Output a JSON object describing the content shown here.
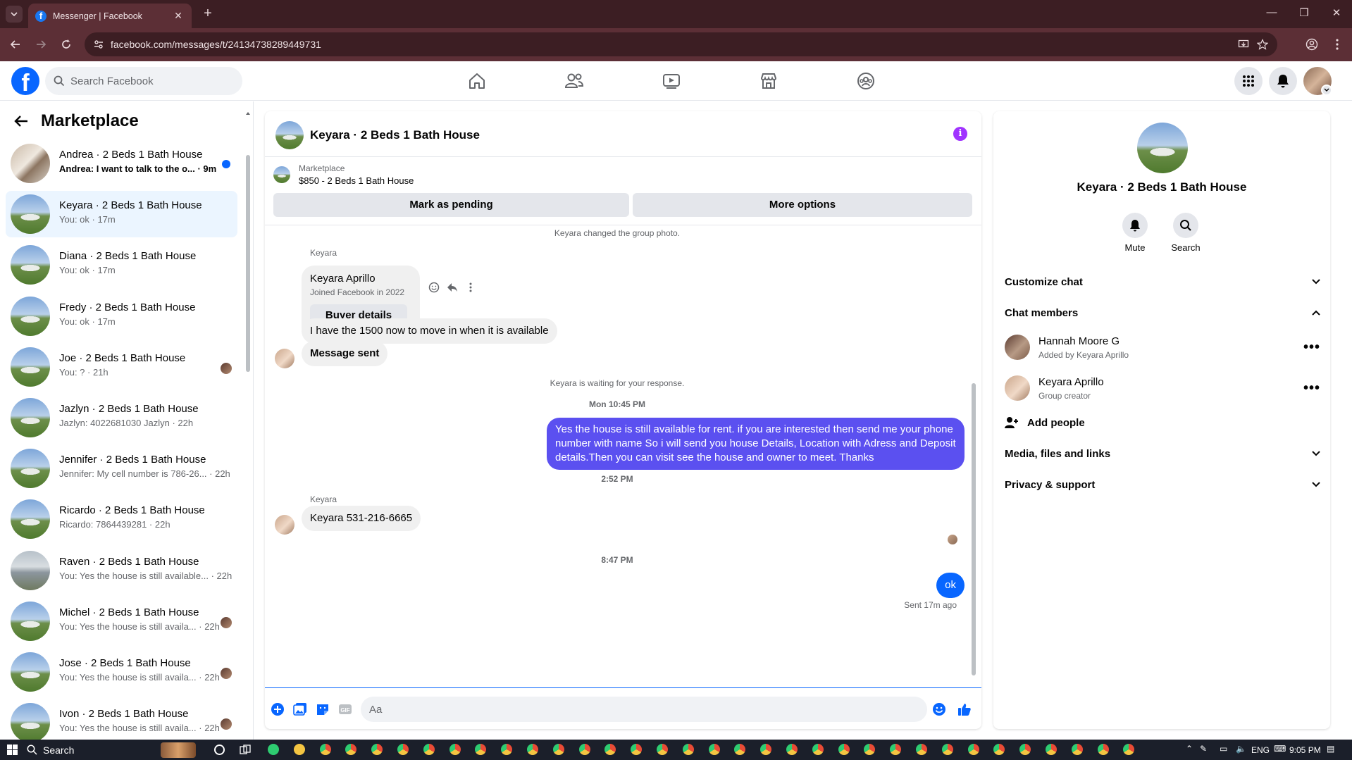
{
  "browser": {
    "tab_title": "Messenger | Facebook",
    "url": "facebook.com/messages/t/24134738289449731"
  },
  "header": {
    "search_placeholder": "Search Facebook"
  },
  "sidebar": {
    "title": "Marketplace",
    "conversations": [
      {
        "name": "Andrea · 2 Beds 1 Bath House",
        "snippet": "Andrea: I want to talk to the o... · 9m",
        "unread": true,
        "thumb": "kitchen"
      },
      {
        "name": "Keyara · 2 Beds 1 Bath House",
        "snippet": "You: ok · 17m",
        "active": true,
        "thumb": "house"
      },
      {
        "name": "Diana · 2 Beds 1 Bath House",
        "snippet": "You: ok · 17m",
        "thumb": "house"
      },
      {
        "name": "Fredy · 2 Beds 1 Bath House",
        "snippet": "You: ok · 17m",
        "thumb": "house"
      },
      {
        "name": "Joe · 2 Beds 1 Bath House",
        "snippet": "You: ? · 21h",
        "seen": true,
        "thumb": "house"
      },
      {
        "name": "Jazlyn · 2 Beds 1 Bath House",
        "snippet": "Jazlyn: 4022681030 Jazlyn · 22h",
        "thumb": "house"
      },
      {
        "name": "Jennifer · 2 Beds 1 Bath House",
        "snippet": "Jennifer: My cell number is 786-26... · 22h",
        "thumb": "house"
      },
      {
        "name": "Ricardo · 2 Beds 1 Bath House",
        "snippet": "Ricardo: 7864439281 · 22h",
        "thumb": "house"
      },
      {
        "name": "Raven · 2 Beds 1 Bath House",
        "snippet": "You: Yes the house is still available... · 22h",
        "thumb": "gray"
      },
      {
        "name": "Michel · 2 Beds 1 Bath House",
        "snippet": "You: Yes the house is still availa... · 22h",
        "seen": true,
        "thumb": "house"
      },
      {
        "name": "Jose · 2 Beds 1 Bath House",
        "snippet": "You: Yes the house is still availa... · 22h",
        "seen": true,
        "thumb": "house"
      },
      {
        "name": "Ivon · 2 Beds 1 Bath House",
        "snippet": "You: Yes the house is still availa... · 22h",
        "seen": true,
        "thumb": "house"
      }
    ]
  },
  "chat": {
    "title": "Keyara · 2 Beds 1 Bath House",
    "marketplace_label": "Marketplace",
    "listing": "$850 - 2 Beds 1 Bath House",
    "mark_pending": "Mark as pending",
    "more_options": "More options",
    "group_photo_note": "Keyara changed the group photo.",
    "sender_1": "Keyara",
    "card_name": "Keyara Aprillo",
    "card_sub": "Joined Facebook in 2022",
    "card_button": "Buyer details",
    "msg_1": "I have the 1500 now to move in when it is available",
    "msg_2": "Message sent",
    "waiting_note": "Keyara is waiting for your response.",
    "time_1": "Mon 10:45 PM",
    "out_msg_1": "Yes the house is still available for rent. if you are interested then send me your phone number with name So i will send you house Details, Location with Adress and Deposit details.Then you can visit see the house and owner to meet. Thanks",
    "time_2": "2:52 PM",
    "sender_2": "Keyara",
    "msg_3": "Keyara 531-216-6665",
    "time_3": "8:47 PM",
    "out_msg_2": "ok",
    "sent_status": "Sent 17m ago",
    "composer_placeholder": "Aa"
  },
  "details": {
    "title": "Keyara · 2 Beds 1 Bath House",
    "mute": "Mute",
    "search": "Search",
    "customize": "Customize chat",
    "members_header": "Chat members",
    "members": [
      {
        "name": "Hannah Moore G",
        "sub": "Added by Keyara Aprillo"
      },
      {
        "name": "Keyara Aprillo",
        "sub": "Group creator"
      }
    ],
    "add_people": "Add people",
    "media": "Media, files and links",
    "privacy": "Privacy & support"
  },
  "taskbar": {
    "search": "Search",
    "lang": "ENG",
    "time": "9:05 PM"
  },
  "colors": {
    "brand": "#0866ff",
    "outgoing_bubble": "#5b50f0",
    "active_conv": "#ebf5ff",
    "info_purple": "#a033ff"
  }
}
